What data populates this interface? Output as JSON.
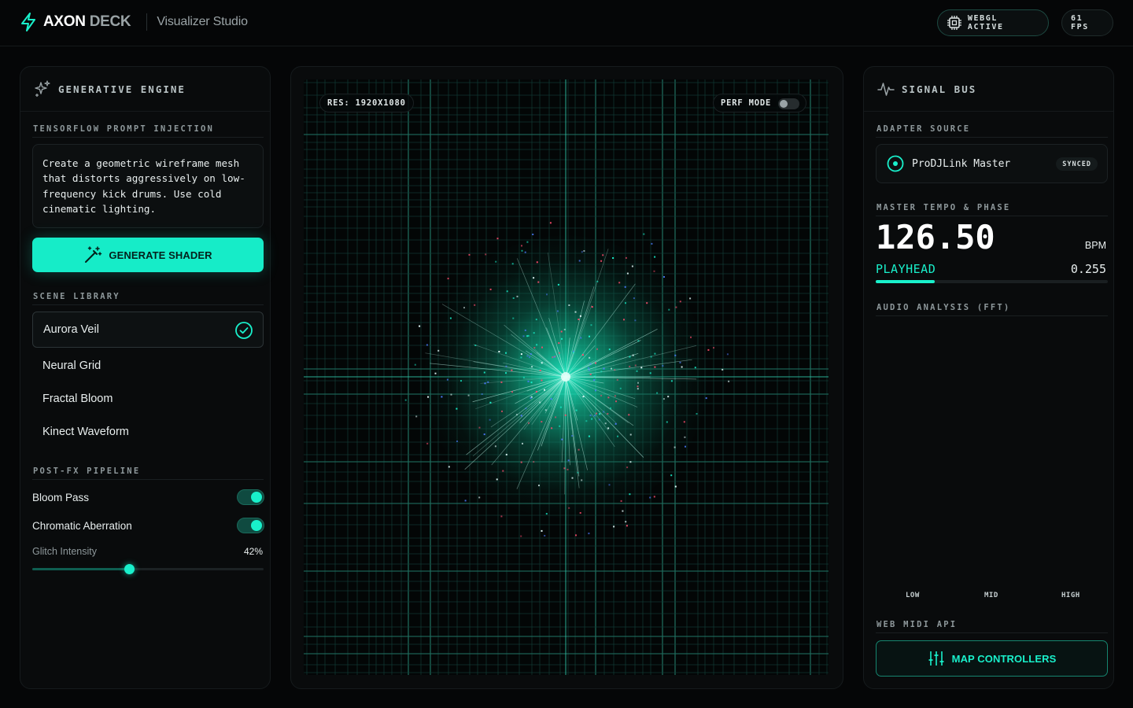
{
  "header": {
    "brand_bold": "AXON",
    "brand_light": "DECK",
    "subtitle": "Visualizer Studio",
    "webgl_status": "WEBGL ACTIVE",
    "fps": "61 FPS"
  },
  "left_panel": {
    "title": "GENERATIVE ENGINE",
    "prompt_section": "TENSORFLOW PROMPT INJECTION",
    "prompt_text": "Create a geometric wireframe mesh that distorts aggressively on low-frequency kick drums. Use cold cinematic lighting.",
    "generate_label": "GENERATE SHADER",
    "scene_section": "SCENE LIBRARY",
    "scenes": [
      {
        "label": "Aurora Veil",
        "active": true
      },
      {
        "label": "Neural Grid",
        "active": false
      },
      {
        "label": "Fractal Bloom",
        "active": false
      },
      {
        "label": "Kinect Waveform",
        "active": false
      }
    ],
    "postfx_section": "POST-FX PIPELINE",
    "postfx": [
      {
        "label": "Bloom Pass",
        "enabled": true
      },
      {
        "label": "Chromatic Aberration",
        "enabled": true
      }
    ],
    "glitch_label": "Glitch Intensity",
    "glitch_value": "42%",
    "glitch_level": 0.42
  },
  "viewport": {
    "resolution": "RES: 1920X1080",
    "perf_mode_label": "PERF MODE",
    "perf_mode_enabled": false
  },
  "right_panel": {
    "title": "SIGNAL BUS",
    "adapter_section": "ADAPTER SOURCE",
    "adapter_name": "ProDJLink Master",
    "adapter_status": "SYNCED",
    "tempo_section": "MASTER TEMPO & PHASE",
    "bpm": "126.50",
    "bpm_unit": "BPM",
    "playhead_label": "PLAYHEAD",
    "playhead_value": "0.255",
    "playhead_progress": 0.255,
    "fft_section": "AUDIO ANALYSIS (FFT)",
    "bands": [
      "LOW",
      "MID",
      "HIGH"
    ],
    "midi_section": "WEB MIDI API",
    "midi_button": "MAP CONTROLLERS"
  },
  "colors": {
    "accent": "#19f0cb",
    "background": "#050607",
    "panel": "#090b0c"
  }
}
